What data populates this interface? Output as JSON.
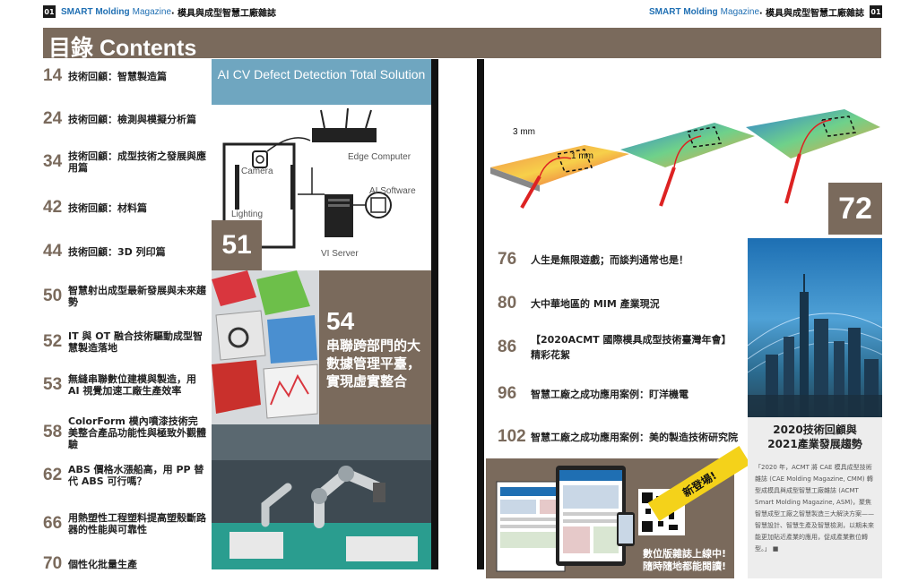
{
  "header": {
    "left_page": "01",
    "right_page": "01",
    "brand_main": "SMART Molding",
    "brand_sub": "Magazine",
    "tagline": "‧ 模具與成型智慧工廠雜誌"
  },
  "contents_title": "目錄 Contents",
  "toc_left": [
    {
      "num": "14",
      "title": "技術回顧：智慧製造篇"
    },
    {
      "num": "24",
      "title": "技術回顧：檢測與模擬分析篇"
    },
    {
      "num": "34",
      "title": "技術回顧：成型技術之發展與應用篇"
    },
    {
      "num": "42",
      "title": "技術回顧：材料篇"
    },
    {
      "num": "44",
      "title": "技術回顧：3D 列印篇"
    },
    {
      "num": "50",
      "title": "智慧射出成型最新發展與未來趨勢"
    },
    {
      "num": "52",
      "title": "IT 與 OT 融合技術驅動成型智慧製造落地"
    },
    {
      "num": "53",
      "title": "無縫串聯數位建模與製造，用 AI 視覺加速工廠生產效率"
    },
    {
      "num": "58",
      "title": "ColorForm 模內噴漆技術完美整合產品功能性與極致外觀體驗"
    },
    {
      "num": "62",
      "title": "ABS 價格水漲船高，用 PP 替代 ABS 可行嗎？"
    },
    {
      "num": "66",
      "title": "用熱塑性工程塑料提高塑殼斷路器的性能與可靠性"
    },
    {
      "num": "70",
      "title": "個性化批量生產"
    }
  ],
  "feature51": {
    "banner": "AI CV Defect Detection Total Solution",
    "labels": {
      "camera": "Camera",
      "lighting": "Lighting",
      "edge": "Edge Computer",
      "ai": "AI Software",
      "vi": "VI Server"
    },
    "page": "51"
  },
  "feature54": {
    "page": "54",
    "title": "串聯跨部門的大數據管理平臺，實現虛實整合"
  },
  "feature72": {
    "page": "72",
    "label_3mm": "3 mm",
    "label_1mm": "1 mm"
  },
  "toc_right": [
    {
      "num": "76",
      "title": "人生是無限遊戲；而談判通常也是！"
    },
    {
      "num": "80",
      "title": "大中華地區的 MIM 產業現況"
    },
    {
      "num": "86",
      "title": "【2020ACMT 國際模具成型技術臺灣年會】精彩花絮"
    },
    {
      "num": "96",
      "title": "智慧工廠之成功應用案例：盯洋機電"
    },
    {
      "num": "102",
      "title": "智慧工廠之成功應用案例：美的製造技術研究院"
    }
  ],
  "digital": {
    "ribbon": "新登場!",
    "caption_line1": "數位版雜誌上線中!",
    "caption_line2": "隨時隨地都能閱讀!"
  },
  "cover": {
    "title_line1": "2020技術回顧與",
    "title_line2": "2021產業發展趨勢",
    "body": "「2020 年，ACMT 將 CAE 模具成型技術雜誌 (CAE Molding Magazine, CMM) 轉型成模具與成型智慧工廠雜誌 (ACMT Smart Molding Magazine, ASM)，聚焦智慧成型工廠之智慧製造三大解決方案——智慧設計、智慧生產及智慧檢測，以期未來能更加貼近產業的應用，促成產業數位轉型。」 ■"
  },
  "colors": {
    "accent": "#7a6a5c",
    "brand_blue": "#1f6fb3",
    "banner_blue": "#6fa6c0",
    "ribbon_yellow": "#f4d21a"
  }
}
